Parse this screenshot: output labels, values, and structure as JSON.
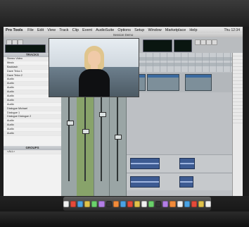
{
  "menu": {
    "app": "Pro Tools",
    "items": [
      "File",
      "Edit",
      "View",
      "Track",
      "Clip",
      "Event",
      "AudioSuite",
      "Options",
      "Setup",
      "Window",
      "Marketplace",
      "Help"
    ],
    "status": "Thu 12:34"
  },
  "window": {
    "title": "Session Demo"
  },
  "panes": {
    "tracks_header": "TRACKS",
    "groups_header": "GROUPS",
    "groups_item": "<ALL>"
  },
  "tracks": [
    "Stereo Video",
    "Music",
    "Backlash",
    "Dave Telco 1",
    "Dave Telco 2",
    "Audio",
    "Audio",
    "Audio",
    "Audio",
    "Audio",
    "Audio",
    "Audio",
    "Dialogue Michael",
    "Dialogue 1",
    "Dialogue Dialogue 2",
    "Audio",
    "Audio",
    "Audio",
    "Audio"
  ],
  "channels": [
    {
      "name": "Audio 1"
    },
    {
      "name": "Audio 2"
    },
    {
      "name": "Dialog"
    },
    {
      "name": "Music"
    }
  ],
  "colors": {
    "screen_bg": "#c9cccf",
    "lcd_text": "#49e06d",
    "region_blue": "#3d5b92"
  }
}
